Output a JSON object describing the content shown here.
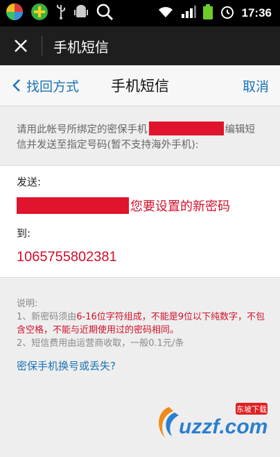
{
  "status_bar": {
    "time": "17:36",
    "icons": [
      "app-launcher-icon",
      "plus-app-icon",
      "usb-icon",
      "android-debug-icon",
      "search-icon",
      "wifi-icon",
      "signal-icon",
      "battery-icon",
      "alarm-icon"
    ]
  },
  "title_bar": {
    "title": "手机短信"
  },
  "nav": {
    "back_label": "找回方式",
    "title": "手机短信",
    "cancel_label": "取消"
  },
  "instruction": {
    "part1": "请用此帐号所绑定的密保手机",
    "part2": "编辑短信并发送至指定号码(暂不支持海外手机):"
  },
  "message": {
    "send_label": "发送:",
    "send_text": "您要设置的新密码",
    "to_label": "到:",
    "number": "1065755802381"
  },
  "notes": {
    "heading": "说明:",
    "item1_prefix": "1、新密码须由",
    "item1_highlight": "6-16位字符组成，不能是9位以下纯数字，不包含空格，不能与近期使用过的密码相同。",
    "item2": "2、短信费用由运营商收取，一般0.1元/条"
  },
  "link": "密保手机换号或丢失?",
  "watermark": {
    "brand": "uzzf.com",
    "tag": "东坡下载"
  },
  "colors": {
    "accent_blue": "#1a73b8",
    "highlight_red": "#d0102a",
    "redaction_red": "#e0142c",
    "titlebar_bg": "#1e1e1e"
  }
}
